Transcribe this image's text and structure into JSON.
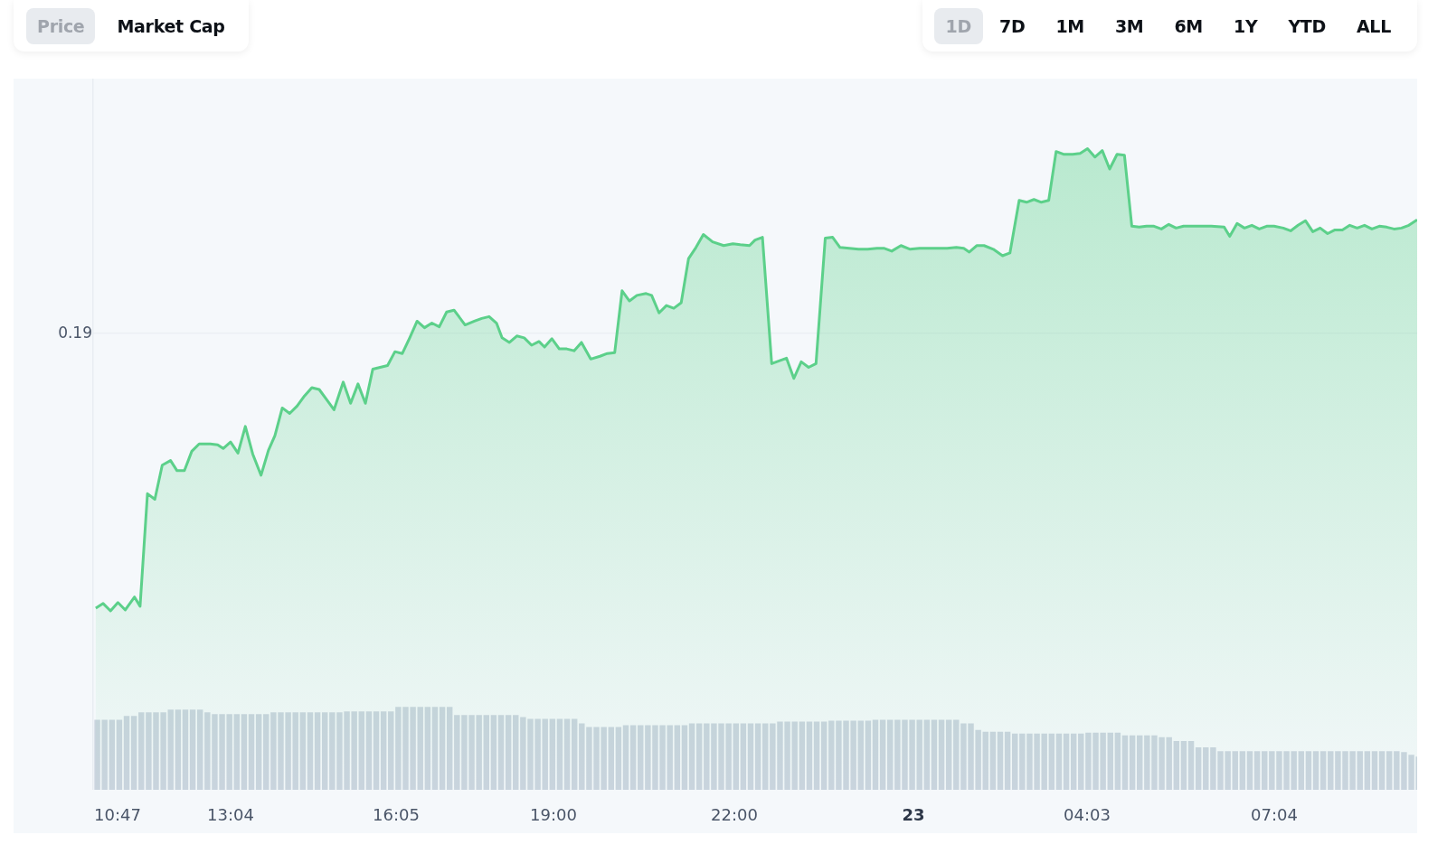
{
  "metric_tabs": [
    {
      "label": "Price",
      "selected": true
    },
    {
      "label": "Market Cap",
      "selected": false
    }
  ],
  "period_tabs": [
    {
      "label": "1D",
      "selected": true
    },
    {
      "label": "7D",
      "selected": false
    },
    {
      "label": "1M",
      "selected": false
    },
    {
      "label": "3M",
      "selected": false
    },
    {
      "label": "6M",
      "selected": false
    },
    {
      "label": "1Y",
      "selected": false
    },
    {
      "label": "YTD",
      "selected": false
    },
    {
      "label": "ALL",
      "selected": false
    }
  ],
  "chart": {
    "y_labels": [
      "0.19"
    ],
    "x_labels": [
      {
        "label": "10:47",
        "kind": "time"
      },
      {
        "label": "13:04",
        "kind": "time"
      },
      {
        "label": "16:05",
        "kind": "time"
      },
      {
        "label": "19:00",
        "kind": "time"
      },
      {
        "label": "22:00",
        "kind": "time"
      },
      {
        "label": "23",
        "kind": "date"
      },
      {
        "label": "04:03",
        "kind": "time"
      },
      {
        "label": "07:04",
        "kind": "time"
      }
    ]
  }
}
